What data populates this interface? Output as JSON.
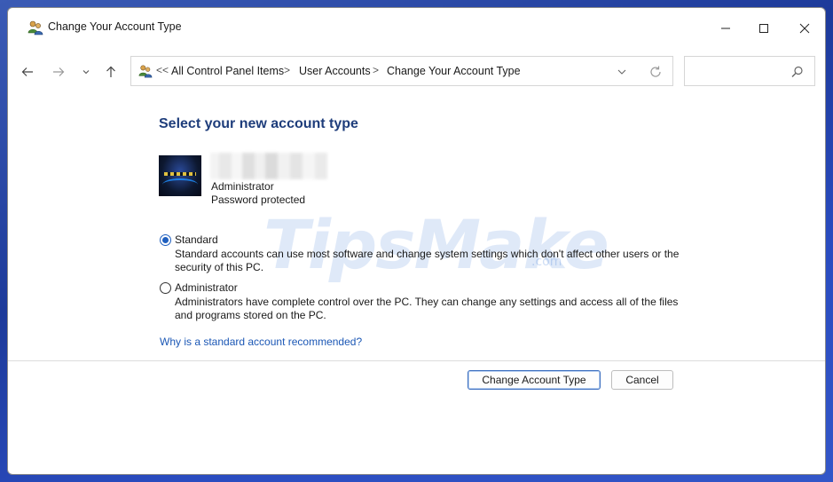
{
  "window": {
    "title": "Change Your Account Type"
  },
  "nav": {
    "breadcrumb": {
      "overflow": "<<",
      "items": [
        "All Control Panel Items",
        "User Accounts",
        "Change Your Account Type"
      ],
      "separator": ">"
    },
    "search": {
      "placeholder": ""
    }
  },
  "main": {
    "heading": "Select your new account type",
    "account": {
      "name": "",
      "type": "Administrator",
      "status": "Password protected"
    },
    "options": [
      {
        "label": "Standard",
        "selected": true,
        "description": "Standard accounts can use most software and change system settings which don't affect other users or the security of this PC."
      },
      {
        "label": "Administrator",
        "selected": false,
        "description": "Administrators have complete control over the PC. They can change any settings and access all of the files and programs stored on the PC."
      }
    ],
    "help_link": "Why is a standard account recommended?"
  },
  "buttons": {
    "change": "Change Account Type",
    "cancel": "Cancel"
  },
  "watermark": {
    "text": "TipsMake",
    "sub": ".com"
  },
  "icons": {
    "title": "users-icon",
    "back": "arrow-left-icon",
    "forward": "arrow-right-icon",
    "recent": "chevron-down-icon",
    "up": "arrow-up-icon",
    "address": "users-icon",
    "dropdown": "chevron-down-icon",
    "refresh": "refresh-icon",
    "search": "search-icon"
  },
  "colors": {
    "heading": "#1e3d7b",
    "link": "#1b57b5",
    "radio_accent": "#1f5fbf",
    "desktop": "#2a4cc0"
  }
}
